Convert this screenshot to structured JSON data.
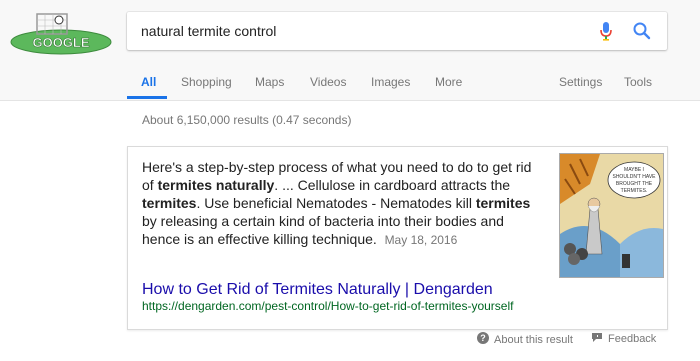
{
  "logo": {
    "text": "GOOGLE"
  },
  "search": {
    "query": "natural termite control"
  },
  "tabs": [
    {
      "label": "All"
    },
    {
      "label": "Shopping"
    },
    {
      "label": "Maps"
    },
    {
      "label": "Videos"
    },
    {
      "label": "Images"
    },
    {
      "label": "More"
    },
    {
      "label": "Settings"
    },
    {
      "label": "Tools"
    }
  ],
  "stats": "About 6,150,000 results (0.47 seconds)",
  "featured": {
    "snippet_parts": [
      "Here's a step-by-step process of what you need to do to get rid of ",
      "termites naturally",
      ". ... Cellulose in cardboard attracts the ",
      "termites",
      ". Use beneficial Nematodes - Nematodes kill ",
      "termites",
      " by releasing a certain kind of bacteria into their bodies and hence is an effective killing technique."
    ],
    "date": "May 18, 2016",
    "title": "How to Get Rid of Termites Naturally | Dengarden",
    "url": "https://dengarden.com/pest-control/How-to-get-rid-of-termites-yourself",
    "comic_bubble": "MAYBE I SHOULDN'T HAVE BROUGHT THE TERMITES."
  },
  "footer": {
    "about": "About this result",
    "feedback": "Feedback"
  }
}
